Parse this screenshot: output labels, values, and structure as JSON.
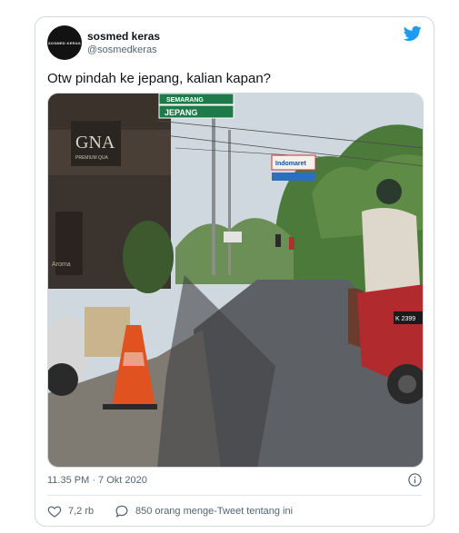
{
  "tweet": {
    "author": {
      "display_name": "sosmed keras",
      "handle": "@sosmedkeras",
      "avatar_text": "SOSMED KERAS"
    },
    "text": "Otw pindah ke jepang, kalian kapan?",
    "timestamp": "11.35 PM · 7 Okt 2020",
    "likes": "7,2 rb",
    "replies_text": "850 orang menge-Tweet tentang ini"
  },
  "photo": {
    "road_sign_top": "SEMARANG",
    "road_sign_bottom": "JEPANG",
    "storefront_text": "GNA",
    "storefront_sub": "PREMIUM QUA",
    "banner_text": "Indomaret",
    "shop_side_text": "Aroma",
    "plate_text": "K 2399"
  },
  "colors": {
    "twitter_blue": "#1d9bf0",
    "sign_green": "#1f7a4a",
    "cone_orange": "#e0521f"
  },
  "icons": {
    "brand": "twitter-bird-icon",
    "info": "info-icon",
    "like": "heart-icon",
    "reply": "speech-bubble-icon"
  }
}
